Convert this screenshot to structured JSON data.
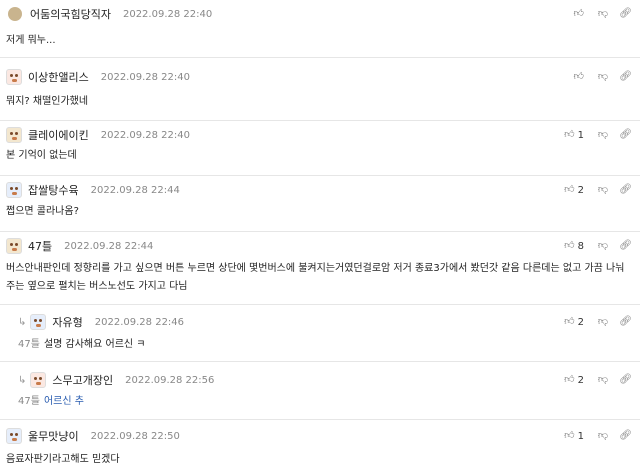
{
  "comments": [
    {
      "nick": "어둠의국힘당직자",
      "time": "2022.09.28 22:40",
      "body": "저게 뭐누...",
      "likes": "",
      "avatar_style": "dot"
    },
    {
      "nick": "이상한앨리스",
      "time": "2022.09.28 22:40",
      "body": "뭐지? 채떨인가했네",
      "likes": "",
      "avatar_style": "red"
    },
    {
      "nick": "클레이에이킨",
      "time": "2022.09.28 22:40",
      "body": "본 기억이 없는데",
      "likes": "1",
      "avatar_style": "tan"
    },
    {
      "nick": "잡쌀탕수육",
      "time": "2022.09.28 22:44",
      "body": "쩝으면 콜라나옴?",
      "likes": "2",
      "avatar_style": "blue"
    },
    {
      "nick": "47틀",
      "time": "2022.09.28 22:44",
      "body": "버스안내판인데 정향리를 가고 싶으면 버튼 누르면 상단에 몇번버스에 불켜지는거였던걸로암 저거 종료3가에서 봤던갓 같음 다른데는 없고 가끔 나눠주는 옆으로 펼치는 버스노선도 가지고 다님",
      "likes": "8",
      "avatar_style": "tan"
    }
  ],
  "replies": [
    {
      "nick": "자유형",
      "time": "2022.09.28 22:46",
      "target": "47틀",
      "body": "설명 감사해요 어르신 ㅋ",
      "likes": "2",
      "arrow": "↳"
    },
    {
      "nick": "스무고개장인",
      "time": "2022.09.28 22:56",
      "target": "47틀",
      "body": "어르신 추",
      "likes": "2",
      "arrow": "↳"
    }
  ],
  "last_comment": {
    "nick": "울무맛냥이",
    "time": "2022.09.28 22:50",
    "body": "음료자판기라고해도 믿겠다",
    "likes": "1"
  },
  "icons": {
    "like": "👍",
    "dislike": "👎",
    "link": "🔗"
  }
}
